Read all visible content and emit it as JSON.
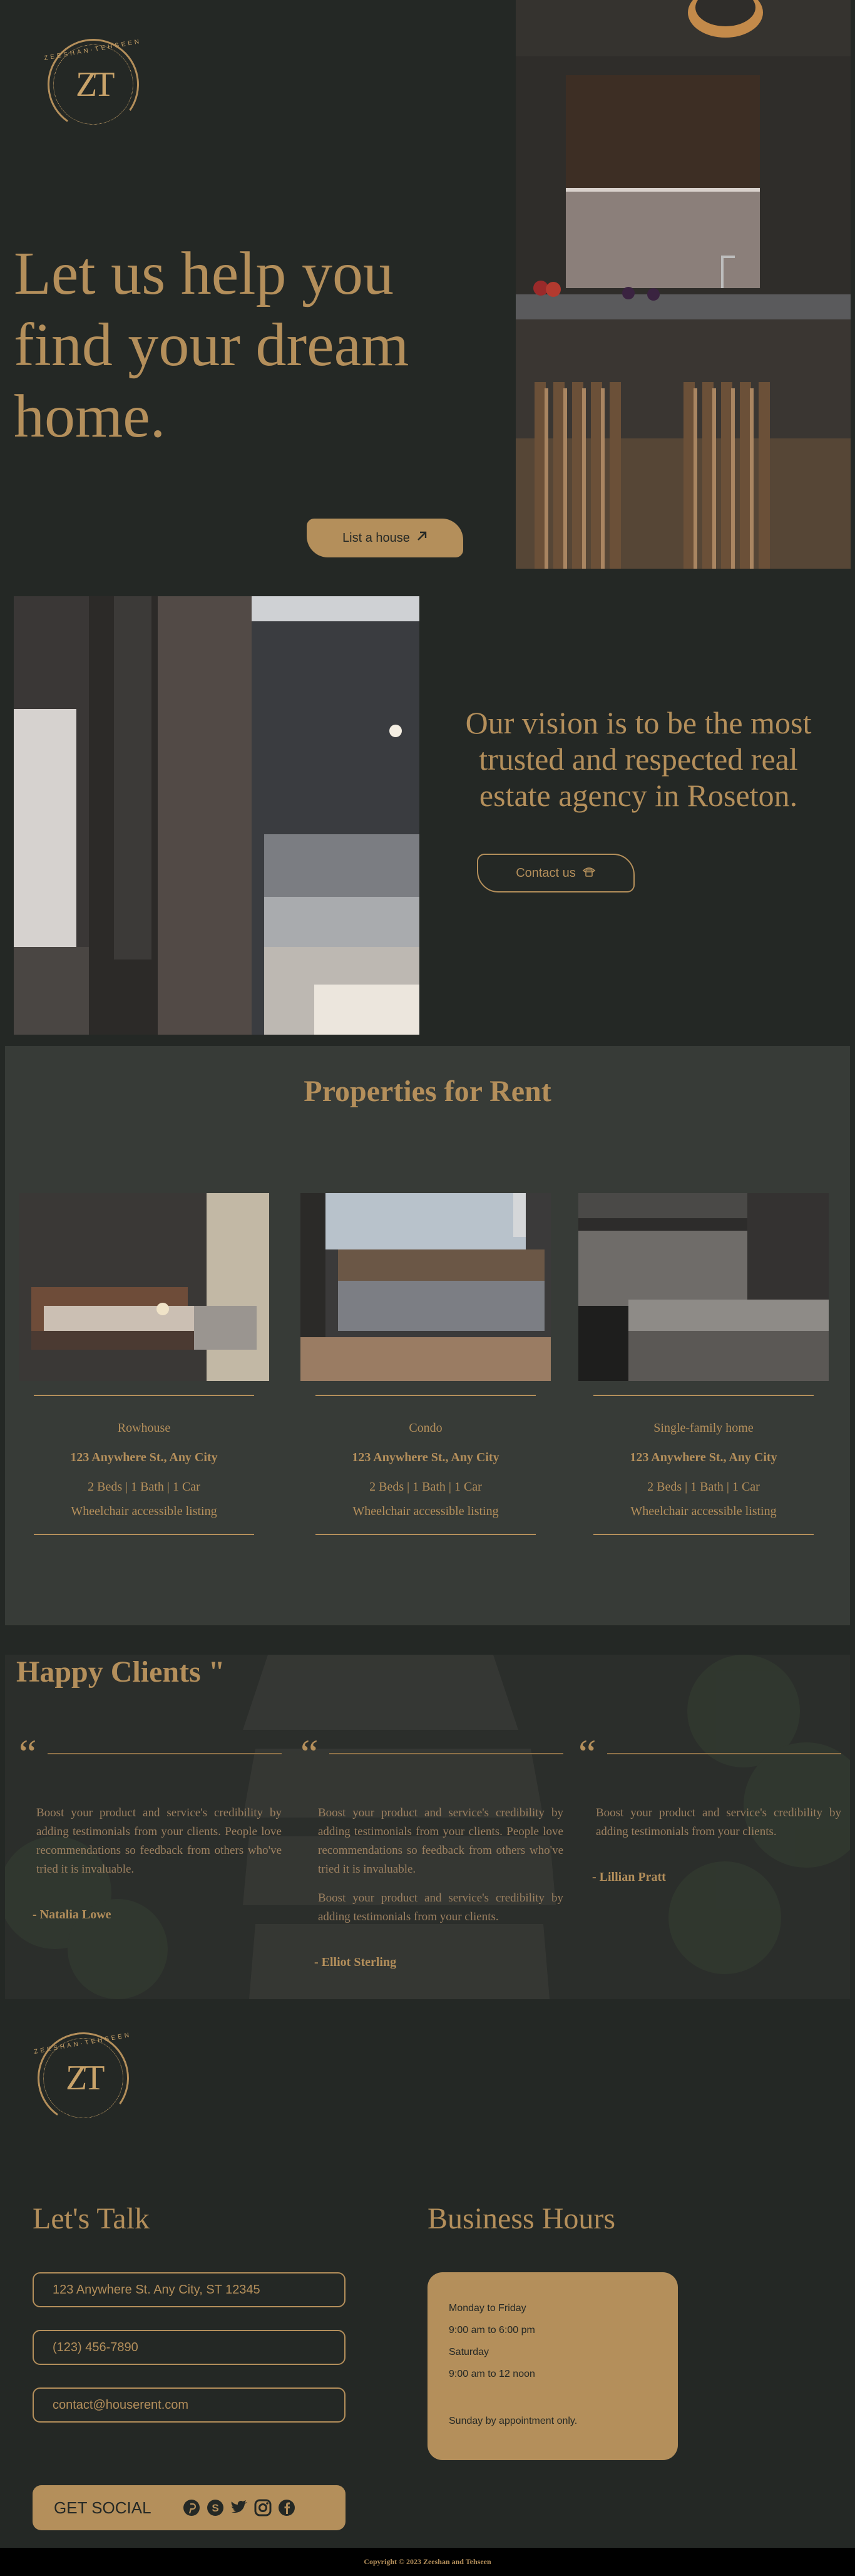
{
  "brand": {
    "logo_letters": "ZT",
    "logo_text": "ZEESHAN·TEHSEEN",
    "colors": {
      "background": "#242825",
      "panel": "#373b37",
      "accent": "#b48f5b",
      "footer_bar": "#000000"
    }
  },
  "hero": {
    "title": "Let us help you find your dream home.",
    "list_button_label": "List a house",
    "list_button_icon": "arrow-up-right-icon"
  },
  "vision": {
    "text": "Our vision is to be the most trusted and respected real estate agency in Roseton.",
    "contact_button_label": "Contact us",
    "contact_button_icon": "phone-icon"
  },
  "properties": {
    "title": "Properties for Rent",
    "items": [
      {
        "type": "Rowhouse",
        "address": "123 Anywhere St., Any City",
        "specs": "2 Beds | 1 Bath | 1 Car",
        "note": "Wheelchair accessible listing"
      },
      {
        "type": "Condo",
        "address": "123 Anywhere St., Any City",
        "specs": "2 Beds | 1 Bath | 1 Car",
        "note": "Wheelchair accessible listing"
      },
      {
        "type": "Single-family home",
        "address": "123 Anywhere St., Any City",
        "specs": "2 Beds | 1 Bath | 1 Car",
        "note": "Wheelchair accessible listing"
      }
    ]
  },
  "clients": {
    "title": "Happy Clients \"",
    "quote_mark": "“",
    "testimonials": [
      {
        "paragraphs": [
          "Boost your product and service's credibility by adding testimonials from your clients. People love recommendations so feedback from others who've tried it is invaluable."
        ],
        "author": "- Natalia Lowe"
      },
      {
        "paragraphs": [
          "Boost your product and service's credibility by adding testimonials from your clients. People love recommendations so feedback from others who've tried it is invaluable.",
          "Boost your product and service's credibility by adding testimonials from your clients."
        ],
        "author": "- Elliot Sterling"
      },
      {
        "paragraphs": [
          "Boost your product and service's credibility by adding testimonials from your clients."
        ],
        "author": "- Lillian Pratt"
      }
    ]
  },
  "footer": {
    "talk_title": "Let's Talk",
    "address": "123 Anywhere St. Any City, ST 12345",
    "phone": "(123) 456-7890",
    "email": "contact@houserent.com",
    "social_label": "GET SOCIAL",
    "social_icons": [
      "pinterest-icon",
      "skype-icon",
      "twitter-icon",
      "instagram-icon",
      "facebook-icon"
    ],
    "hours_title": "Business Hours",
    "hours": [
      "Monday to Friday",
      "9:00 am to 6:00 pm",
      "Saturday",
      "9:00 am to 12 noon"
    ],
    "hours_note": "Sunday by appointment only.",
    "copyright": "Copyright © 2023 Zeeshan and Tehseen"
  }
}
